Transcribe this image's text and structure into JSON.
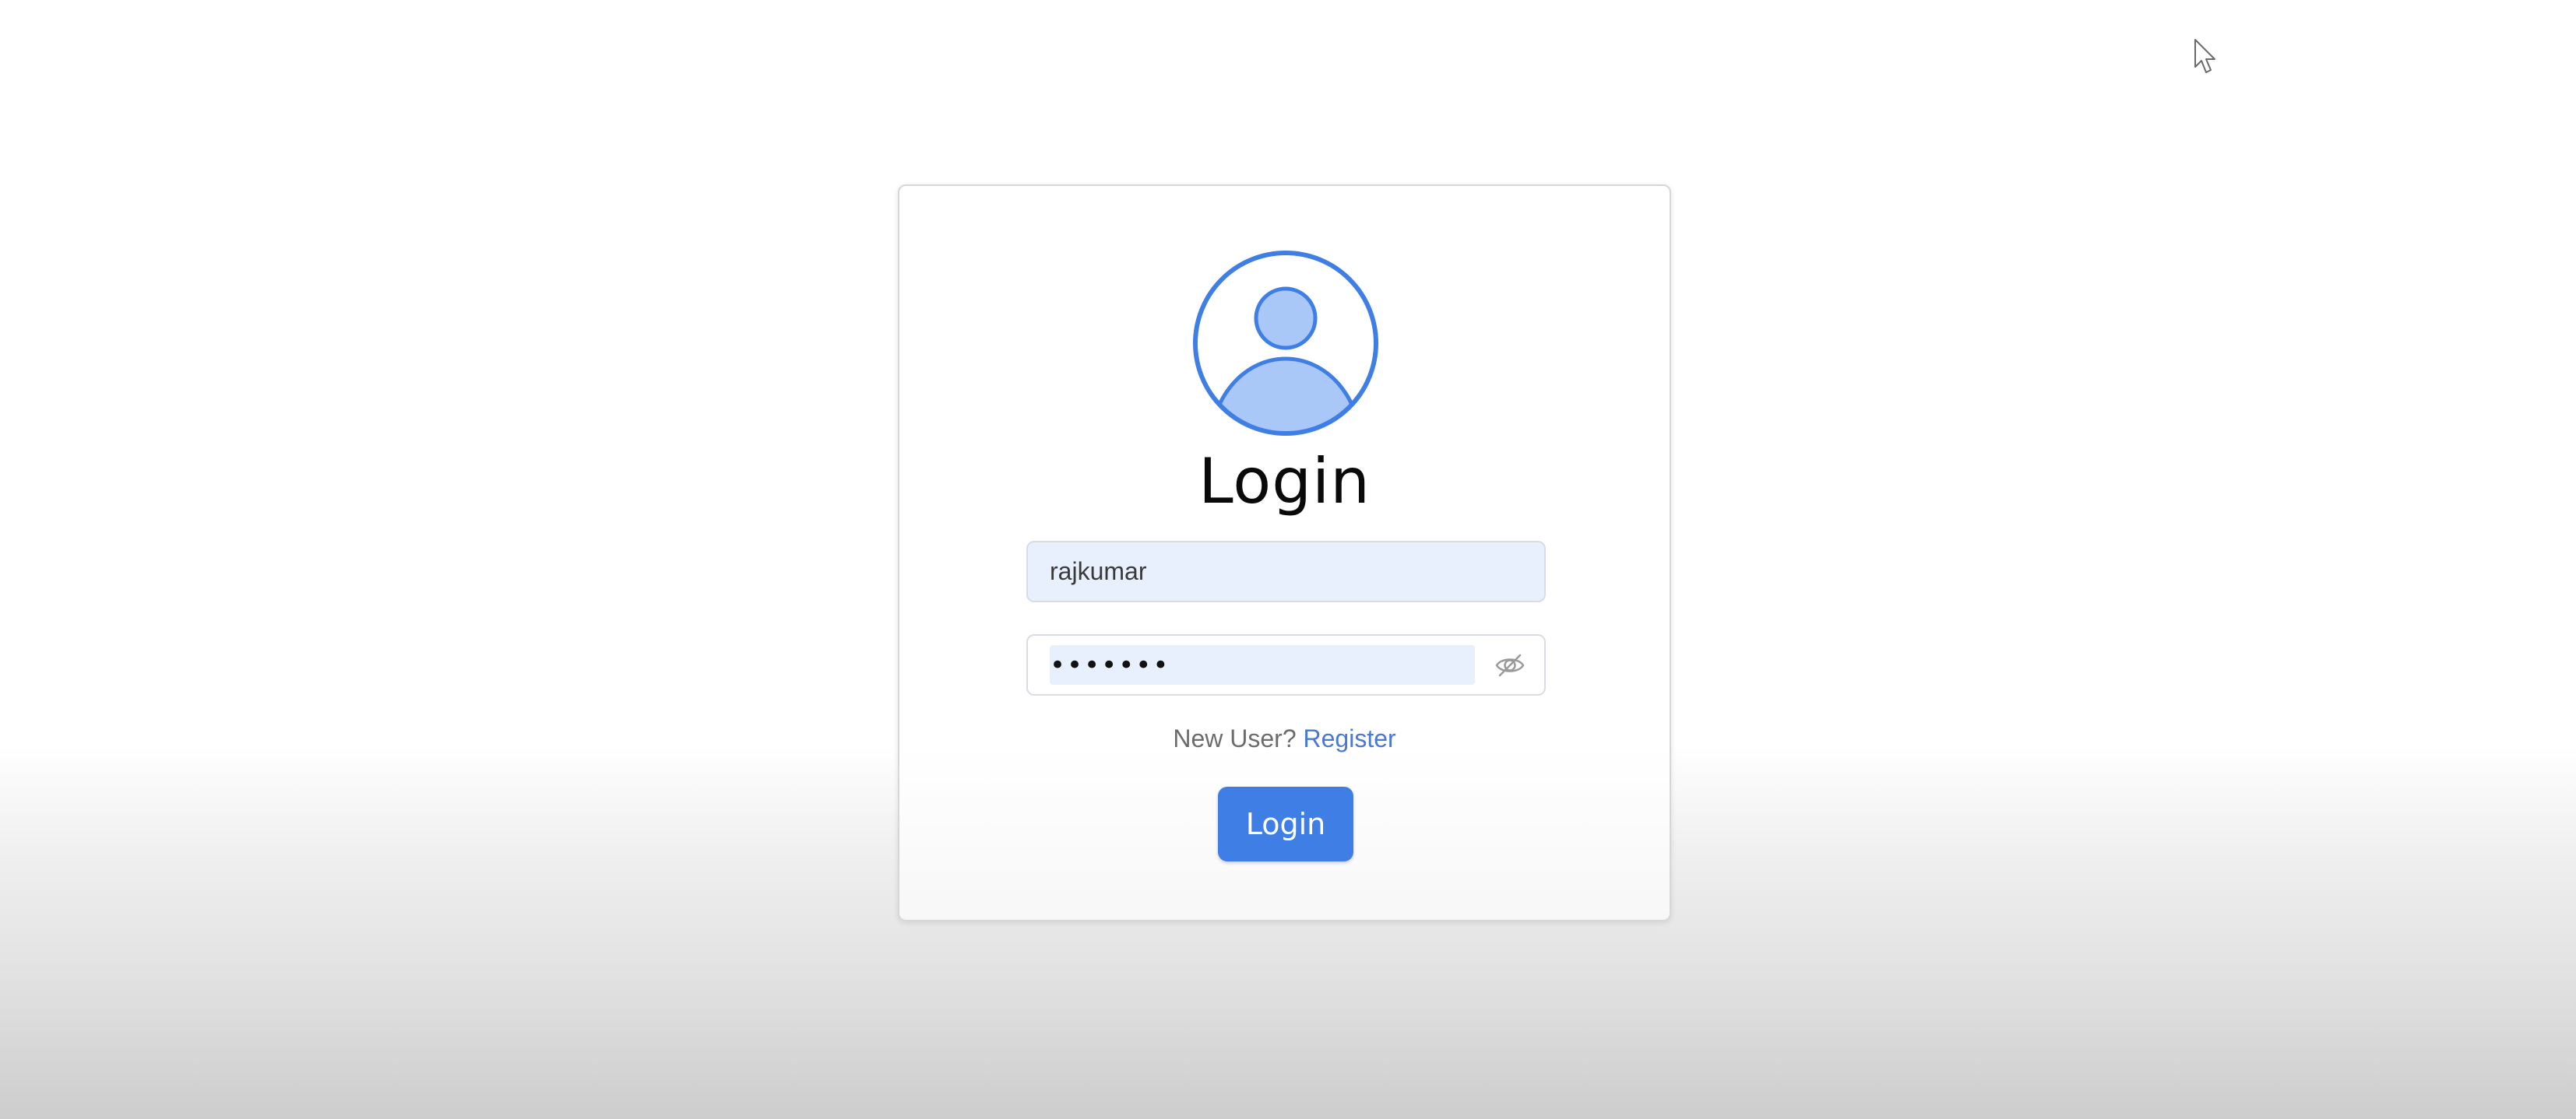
{
  "login_form": {
    "avatar_icon": "user-avatar-icon",
    "title": "Login",
    "username_value": "rajkumar",
    "password_value": "•••••••",
    "password_toggle_icon": "eye-slash-icon",
    "new_user_text": "New User?",
    "register_link": "Register",
    "submit_label": "Login"
  },
  "colors": {
    "accent": "#3f7fe5",
    "avatar_stroke": "#3f7fe5",
    "avatar_fill": "#a9c8f7",
    "input_autofill_bg": "#e8f0fe",
    "link": "#4a78d6"
  },
  "cursor_icon": "mouse-pointer-icon"
}
